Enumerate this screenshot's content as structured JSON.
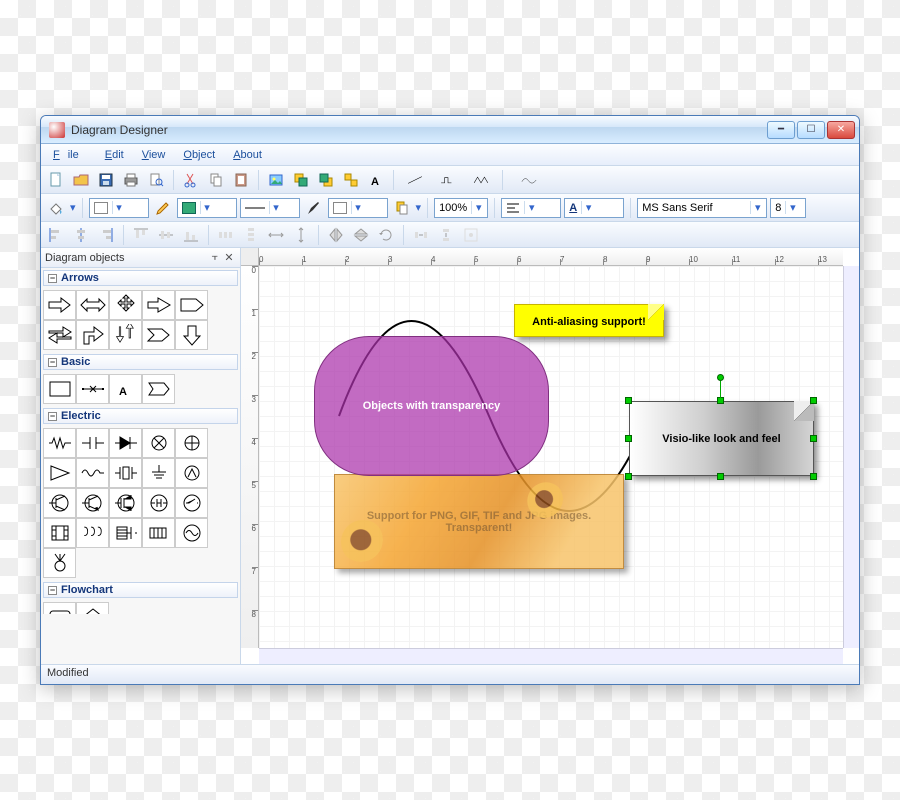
{
  "window": {
    "title": "Diagram Designer"
  },
  "menu": {
    "file": "File",
    "edit": "Edit",
    "view": "View",
    "object": "Object",
    "about": "About"
  },
  "toolbar2": {
    "zoom": "100%",
    "font_letter": "A",
    "font_name": "MS Sans Serif",
    "font_size": "8"
  },
  "side": {
    "title": "Diagram objects",
    "cat_arrows": "Arrows",
    "cat_basic": "Basic",
    "cat_electric": "Electric",
    "cat_flow": "Flowchart"
  },
  "canvas": {
    "note": "Anti-aliasing support!",
    "rounded": "Objects with transparency",
    "scroll": "Visio-like look and feel",
    "banner": "Support for PNG, GIF, TIF and JPG images. Transparent!"
  },
  "status": {
    "text": "Modified"
  },
  "ruler": {
    "ticks_h": [
      "0",
      "1",
      "2",
      "3",
      "4",
      "5",
      "6",
      "7",
      "8",
      "9",
      "10",
      "11",
      "12",
      "13"
    ],
    "ticks_v": [
      "0",
      "1",
      "2",
      "3",
      "4",
      "5",
      "6",
      "7",
      "8"
    ]
  }
}
